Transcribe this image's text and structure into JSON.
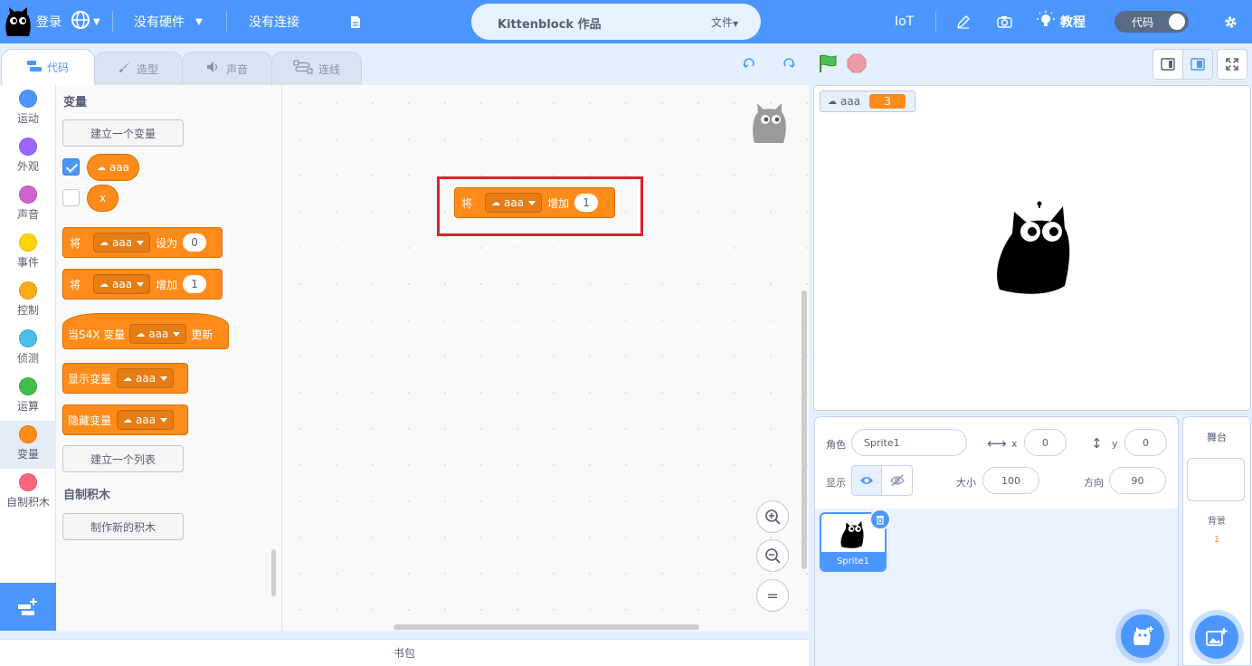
{
  "menubar": {
    "login": "登录",
    "hardware": "没有硬件",
    "connection": "没有连接",
    "project_title": "Kittenblock 作品",
    "file_menu": "文件",
    "iot": "IoT",
    "tutorial": "教程",
    "code_toggle": "代码"
  },
  "tabs": [
    {
      "label": "代码"
    },
    {
      "label": "造型"
    },
    {
      "label": "声音"
    },
    {
      "label": "连线"
    }
  ],
  "categories": [
    {
      "label": "运动",
      "color": "#4c97ff"
    },
    {
      "label": "外观",
      "color": "#9966ff"
    },
    {
      "label": "声音",
      "color": "#cf63cf"
    },
    {
      "label": "事件",
      "color": "#ffd500"
    },
    {
      "label": "控制",
      "color": "#ffab19"
    },
    {
      "label": "侦测",
      "color": "#4cbfe6"
    },
    {
      "label": "运算",
      "color": "#40bf4a"
    },
    {
      "label": "变量",
      "color": "#ff8c1a"
    },
    {
      "label": "自制积木",
      "color": "#ff6680"
    }
  ],
  "palette": {
    "variables_heading": "变量",
    "make_variable": "建立一个变量",
    "variables": [
      {
        "name": "aaa",
        "checked": true,
        "cloud": true
      },
      {
        "name": "x",
        "checked": false,
        "cloud": false
      }
    ],
    "set_block": {
      "prefix": "将",
      "variable": "aaa",
      "verb": "设为",
      "value": "0"
    },
    "change_block": {
      "prefix": "将",
      "variable": "aaa",
      "verb": "增加",
      "value": "1"
    },
    "hat_block": {
      "prefix": "当S4X 变量",
      "variable": "aaa",
      "suffix": "更新"
    },
    "show_block": {
      "prefix": "显示变量",
      "variable": "aaa"
    },
    "hide_block": {
      "prefix": "隐藏变量",
      "variable": "aaa"
    },
    "make_list": "建立一个列表",
    "my_blocks_heading": "自制积木",
    "make_block": "制作新的积木"
  },
  "workspace": {
    "block": {
      "prefix": "将",
      "variable": "aaa",
      "verb": "增加",
      "value": "1"
    },
    "zoom_reset": "="
  },
  "backpack": "书包",
  "stage": {
    "monitor_name": "aaa",
    "monitor_value": "3"
  },
  "sprite_info": {
    "sprite_label": "角色",
    "sprite_name": "Sprite1",
    "x_label": "x",
    "x_value": "0",
    "y_label": "y",
    "y_value": "0",
    "show_label": "显示",
    "size_label": "大小",
    "size_value": "100",
    "direction_label": "方向",
    "direction_value": "90"
  },
  "sprites": [
    {
      "name": "Sprite1"
    }
  ],
  "stage_pane": {
    "title": "舞台",
    "backdrop_label": "背景",
    "backdrop_count": "1"
  },
  "colors": {
    "accent": "#4c97ff",
    "variables": "#ff8c1a",
    "highlight": "#e0202a"
  }
}
